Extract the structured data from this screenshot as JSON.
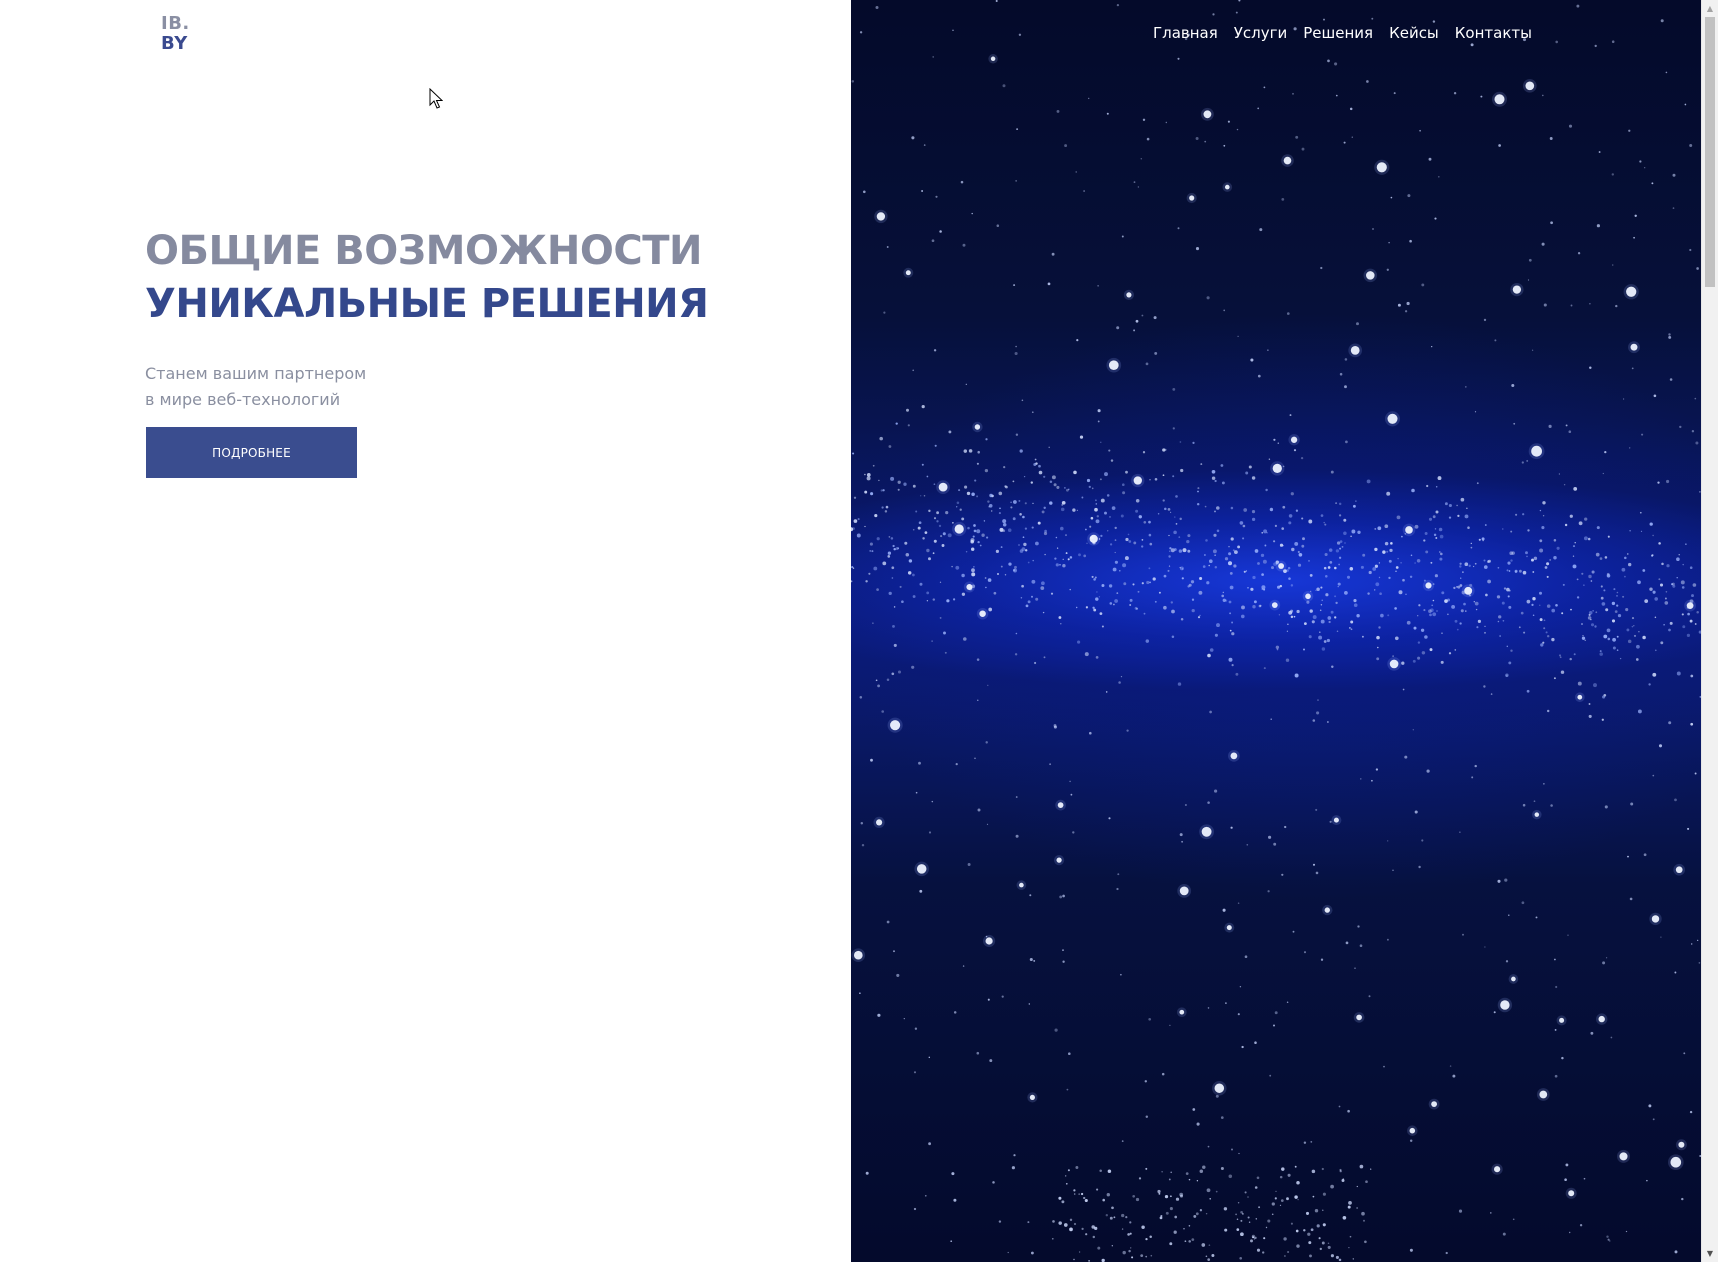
{
  "logo": {
    "line1": "IB.",
    "line2": "BY"
  },
  "nav": {
    "items": [
      "Главная",
      "Услуги",
      "Решения",
      "Кейсы",
      "Контакты"
    ]
  },
  "hero": {
    "title_line1": "ОБЩИЕ ВОЗМОЖНОСТИ",
    "title_line2": "УНИКАЛЬНЫЕ РЕШЕНИЯ",
    "subtitle_line1": "Станем вашим партнером",
    "subtitle_line2": "в мире веб-технологий",
    "button_label": "ПОДРОБНЕЕ"
  },
  "colors": {
    "accent": "#3a4d8f",
    "title_gray": "#858a9f",
    "title_blue": "#34488c",
    "space_dark": "#040a2a",
    "space_glow": "#1a3ce0"
  },
  "icons": {
    "cursor": "mouse-pointer-icon",
    "scroll_up": "scroll-up-arrow-icon",
    "scroll_down": "scroll-down-arrow-icon"
  }
}
